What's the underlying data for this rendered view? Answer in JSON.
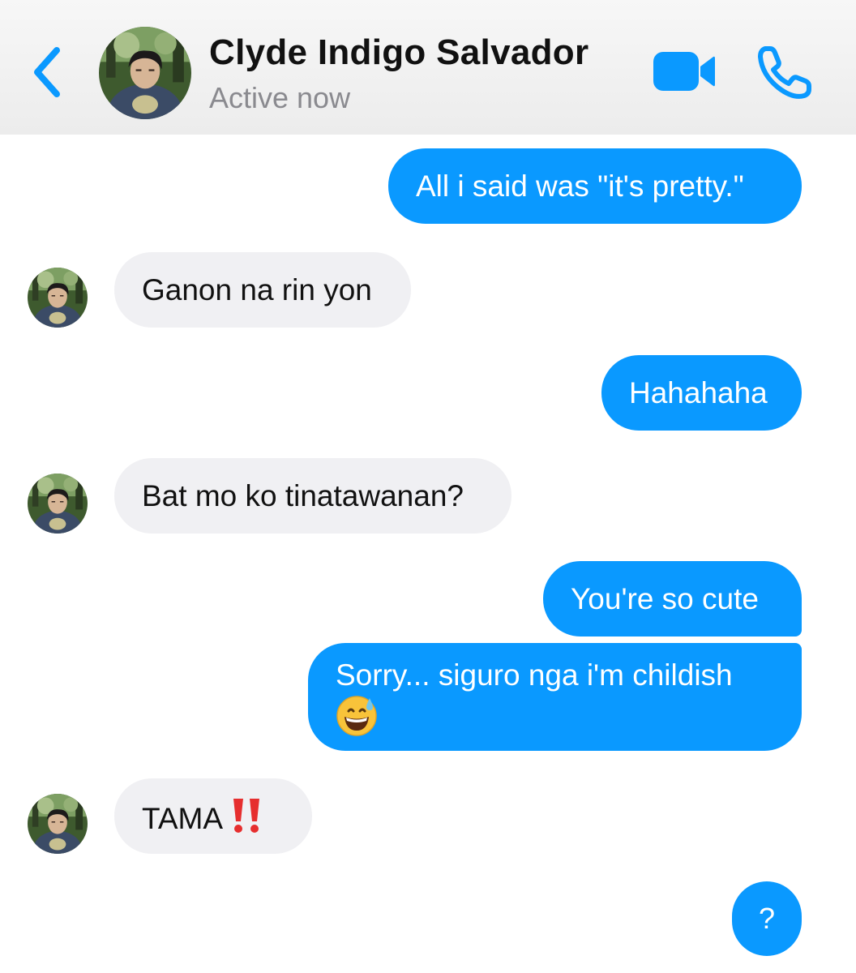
{
  "header": {
    "contact_name": "Clyde Indigo Salvador",
    "status": "Active now",
    "back_icon": "chevron-left-icon",
    "video_icon": "video-camera-icon",
    "call_icon": "phone-icon",
    "accent_color": "#0a99ff"
  },
  "messages": [
    {
      "direction": "outgoing",
      "text": "All i said was \"it's pretty.\""
    },
    {
      "direction": "incoming",
      "text": "Ganon na rin yon"
    },
    {
      "direction": "outgoing",
      "text": "Hahahaha"
    },
    {
      "direction": "incoming",
      "text": "Bat mo ko tinatawanan?"
    },
    {
      "direction": "outgoing",
      "text": "You're so cute"
    },
    {
      "direction": "outgoing",
      "text": "Sorry... siguro nga i'm childish",
      "emoji": "grinning-sweat-emoji"
    },
    {
      "direction": "incoming",
      "text": "TAMA",
      "emoji": "double-exclamation-emoji"
    }
  ],
  "help_button": {
    "label": "?"
  },
  "colors": {
    "outgoing_bubble": "#0a99ff",
    "incoming_bubble": "#f0f0f3",
    "header_background": "#f2f2f2"
  }
}
